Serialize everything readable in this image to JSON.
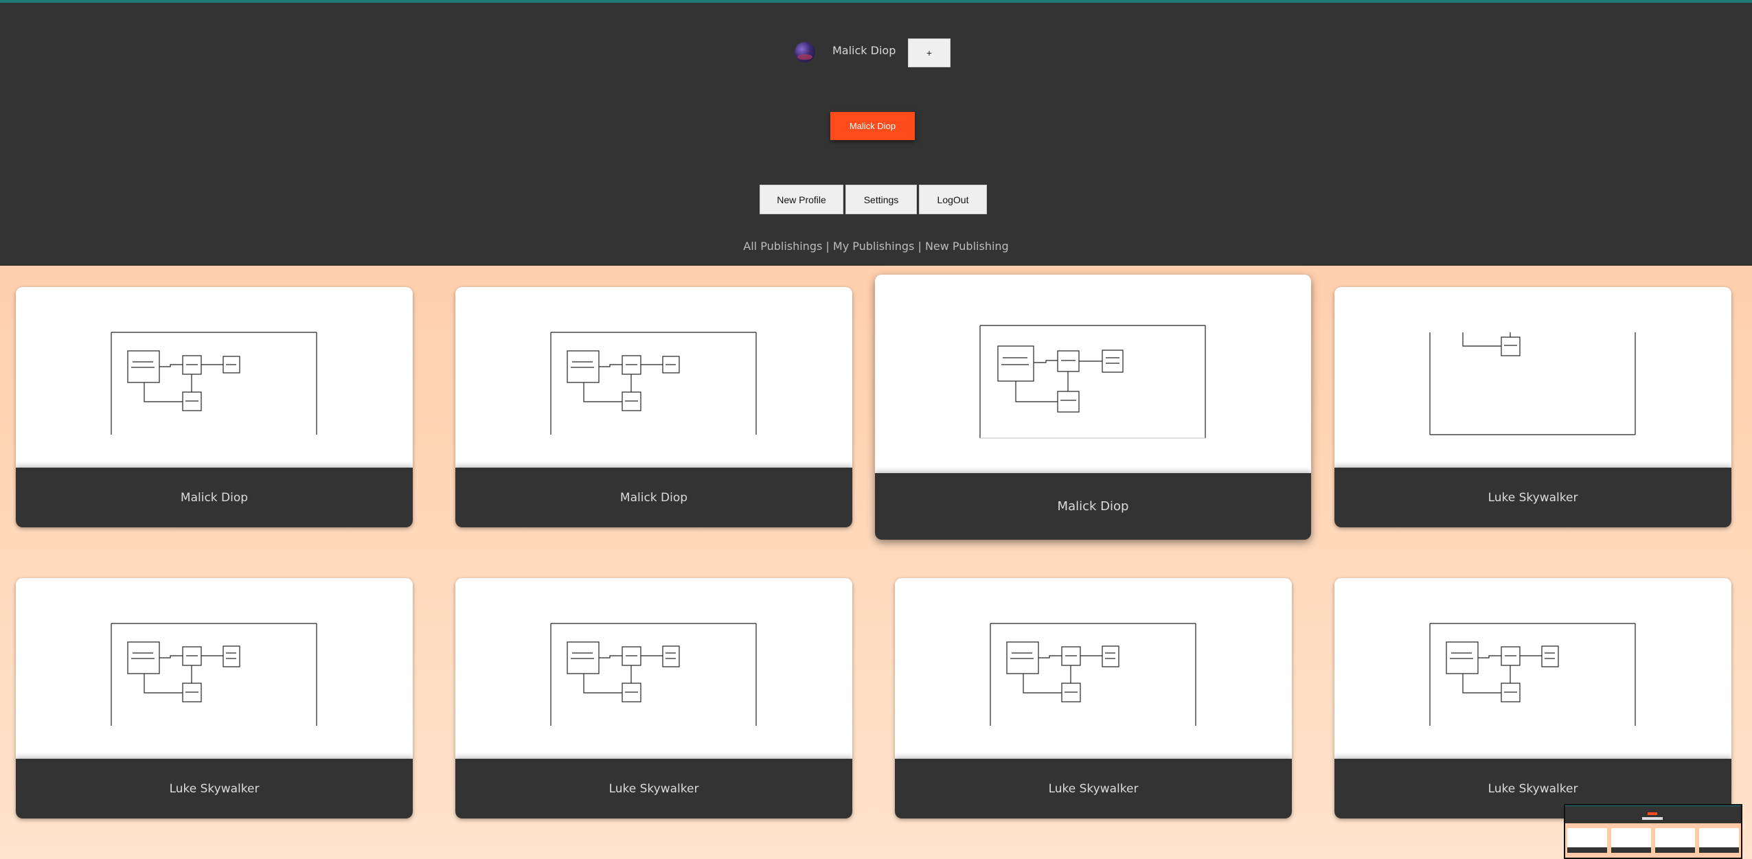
{
  "header": {
    "user_name": "Malick Diop",
    "add_label": "+",
    "active_profile_label": "Malick Diop",
    "buttons": {
      "new_profile": "New Profile",
      "settings": "Settings",
      "logout": "LogOut"
    },
    "links": {
      "all": "All Publishings",
      "mine": "My Publishings",
      "new": "New Publishing",
      "separator": "|"
    }
  },
  "cards": [
    {
      "author": "Malick Diop"
    },
    {
      "author": "Malick Diop"
    },
    {
      "author": "Malick Diop"
    },
    {
      "author": "Luke Skywalker"
    },
    {
      "author": "Luke Skywalker"
    },
    {
      "author": "Luke Skywalker"
    },
    {
      "author": "Luke Skywalker"
    },
    {
      "author": "Luke Skywalker"
    }
  ],
  "colors": {
    "header_bg": "#333333",
    "accent": "#ff4a1a",
    "page_bg": "#ffc7a1"
  }
}
